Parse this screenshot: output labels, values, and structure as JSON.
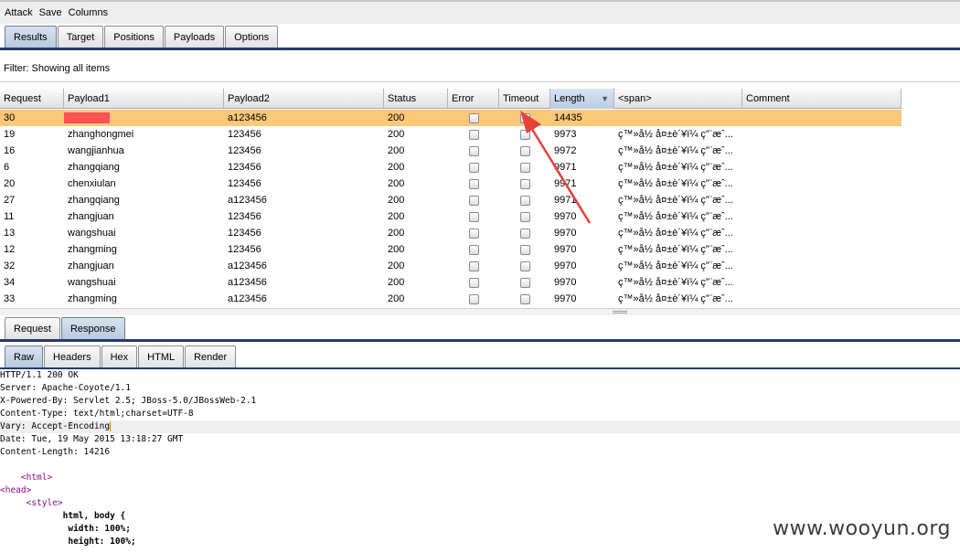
{
  "menu": [
    "Attack",
    "Save",
    "Columns"
  ],
  "main_tabs": [
    "Results",
    "Target",
    "Positions",
    "Payloads",
    "Options"
  ],
  "filter_text": "Filter:  Showing all items",
  "columns": [
    "Request",
    "Payload1",
    "Payload2",
    "Status",
    "Error",
    "Timeout",
    "Length",
    "<span>",
    "Comment"
  ],
  "sorted_column": "Length",
  "rows": [
    {
      "request": "30",
      "payload1": "",
      "payload2": "a123456",
      "status": "200",
      "length": "14435",
      "span": "",
      "selected": true
    },
    {
      "request": "19",
      "payload1": "zhanghongmei",
      "payload2": "123456",
      "status": "200",
      "length": "9973",
      "span": "ç™»å½  å¤±è´¥ï¼  ç”¨æˆ..."
    },
    {
      "request": "16",
      "payload1": "wangjianhua",
      "payload2": "123456",
      "status": "200",
      "length": "9972",
      "span": "ç™»å½  å¤±è´¥ï¼  ç”¨æˆ..."
    },
    {
      "request": "6",
      "payload1": "zhangqiang",
      "payload2": "123456",
      "status": "200",
      "length": "9971",
      "span": "ç™»å½  å¤±è´¥ï¼  ç”¨æˆ..."
    },
    {
      "request": "20",
      "payload1": "chenxiulan",
      "payload2": "123456",
      "status": "200",
      "length": "9971",
      "span": "ç™»å½  å¤±è´¥ï¼  ç”¨æˆ..."
    },
    {
      "request": "27",
      "payload1": "zhangqiang",
      "payload2": "a123456",
      "status": "200",
      "length": "9971",
      "span": "ç™»å½  å¤±è´¥ï¼  ç”¨æˆ..."
    },
    {
      "request": "11",
      "payload1": "zhangjuan",
      "payload2": "123456",
      "status": "200",
      "length": "9970",
      "span": "ç™»å½  å¤±è´¥ï¼  ç”¨æˆ..."
    },
    {
      "request": "13",
      "payload1": "wangshuai",
      "payload2": "123456",
      "status": "200",
      "length": "9970",
      "span": "ç™»å½  å¤±è´¥ï¼  ç”¨æˆ..."
    },
    {
      "request": "12",
      "payload1": "zhangming",
      "payload2": "123456",
      "status": "200",
      "length": "9970",
      "span": "ç™»å½  å¤±è´¥ï¼  ç”¨æˆ..."
    },
    {
      "request": "32",
      "payload1": "zhangjuan",
      "payload2": "a123456",
      "status": "200",
      "length": "9970",
      "span": "ç™»å½  å¤±è´¥ï¼  ç”¨æˆ..."
    },
    {
      "request": "34",
      "payload1": "wangshuai",
      "payload2": "a123456",
      "status": "200",
      "length": "9970",
      "span": "ç™»å½  å¤±è´¥ï¼  ç”¨æˆ..."
    },
    {
      "request": "33",
      "payload1": "zhangming",
      "payload2": "a123456",
      "status": "200",
      "length": "9970",
      "span": "ç™»å½  å¤±è´¥ï¼  ç”¨æˆ..."
    }
  ],
  "detail_tabs": [
    "Request",
    "Response"
  ],
  "view_tabs": [
    "Raw",
    "Headers",
    "Hex",
    "HTML",
    "Render"
  ],
  "response_lines": [
    "HTTP/1.1 200 OK",
    "Server: Apache-Coyote/1.1",
    "X-Powered-By: Servlet 2.5; JBoss-5.0/JBossWeb-2.1",
    "Content-Type: text/html;charset=UTF-8",
    "Vary: Accept-Encoding",
    "Date: Tue, 19 May 2015 13:18:27 GMT",
    "Content-Length: 14216",
    "",
    "    <html>",
    "<head>",
    "     <style>",
    "            html, body {",
    "             width: 100%;",
    "             height: 100%;"
  ],
  "watermark": "www.wooyun.org",
  "colors": {
    "selected_row": "#fbc87a",
    "annotation_arrow": "#e8413c",
    "redaction": "#fa5454",
    "tab_line": "#233a6b"
  }
}
